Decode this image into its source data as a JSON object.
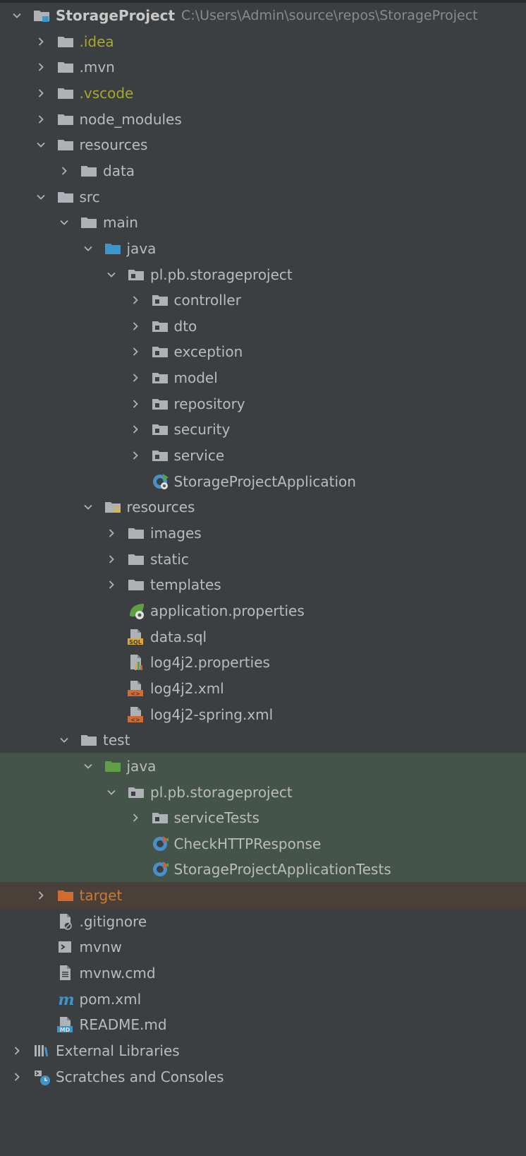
{
  "project": {
    "name": "StorageProject",
    "path": "C:\\Users\\Admin\\source\\repos\\StorageProject"
  },
  "colors": {
    "text": "#bbbbbb",
    "excluded": "#a8a82c",
    "target": "#c87a38",
    "test_highlight": "#45544a",
    "target_highlight": "#4a4039",
    "folder": "#aeb1b5",
    "java_source": "#3e95c9",
    "java_test": "#5fa046",
    "target_folder": "#d36b2f"
  },
  "tree": [
    {
      "label": "StorageProject",
      "depth": 0,
      "expanded": true,
      "icon": "project-folder-icon",
      "bold": true
    },
    {
      "label": ".idea",
      "depth": 1,
      "expanded": false,
      "icon": "folder-icon",
      "style": "olive"
    },
    {
      "label": ".mvn",
      "depth": 1,
      "expanded": false,
      "icon": "folder-icon"
    },
    {
      "label": ".vscode",
      "depth": 1,
      "expanded": false,
      "icon": "folder-icon",
      "style": "olive"
    },
    {
      "label": "node_modules",
      "depth": 1,
      "expanded": false,
      "icon": "folder-icon"
    },
    {
      "label": "resources",
      "depth": 1,
      "expanded": true,
      "icon": "folder-icon"
    },
    {
      "label": "data",
      "depth": 2,
      "expanded": false,
      "icon": "folder-icon"
    },
    {
      "label": "src",
      "depth": 1,
      "expanded": true,
      "icon": "folder-icon"
    },
    {
      "label": "main",
      "depth": 2,
      "expanded": true,
      "icon": "folder-icon"
    },
    {
      "label": "java",
      "depth": 3,
      "expanded": true,
      "icon": "source-folder-icon"
    },
    {
      "label": "pl.pb.storageproject",
      "depth": 4,
      "expanded": true,
      "icon": "package-icon"
    },
    {
      "label": "controller",
      "depth": 5,
      "expanded": false,
      "icon": "package-icon"
    },
    {
      "label": "dto",
      "depth": 5,
      "expanded": false,
      "icon": "package-icon"
    },
    {
      "label": "exception",
      "depth": 5,
      "expanded": false,
      "icon": "package-icon"
    },
    {
      "label": "model",
      "depth": 5,
      "expanded": false,
      "icon": "package-icon"
    },
    {
      "label": "repository",
      "depth": 5,
      "expanded": false,
      "icon": "package-icon"
    },
    {
      "label": "security",
      "depth": 5,
      "expanded": false,
      "icon": "package-icon"
    },
    {
      "label": "service",
      "depth": 5,
      "expanded": false,
      "icon": "package-icon"
    },
    {
      "label": "StorageProjectApplication",
      "depth": 5,
      "icon": "spring-boot-class-icon"
    },
    {
      "label": "resources",
      "depth": 3,
      "expanded": true,
      "icon": "resources-folder-icon"
    },
    {
      "label": "images",
      "depth": 4,
      "expanded": false,
      "icon": "folder-icon"
    },
    {
      "label": "static",
      "depth": 4,
      "expanded": false,
      "icon": "folder-icon"
    },
    {
      "label": "templates",
      "depth": 4,
      "expanded": false,
      "icon": "folder-icon"
    },
    {
      "label": "application.properties",
      "depth": 4,
      "icon": "spring-properties-icon"
    },
    {
      "label": "data.sql",
      "depth": 4,
      "icon": "sql-file-icon"
    },
    {
      "label": "log4j2.properties",
      "depth": 4,
      "icon": "properties-file-icon"
    },
    {
      "label": "log4j2.xml",
      "depth": 4,
      "icon": "xml-file-icon"
    },
    {
      "label": "log4j2-spring.xml",
      "depth": 4,
      "icon": "xml-file-icon"
    },
    {
      "label": "test",
      "depth": 2,
      "expanded": true,
      "icon": "folder-icon"
    },
    {
      "label": "java",
      "depth": 3,
      "expanded": true,
      "icon": "test-source-folder-icon",
      "highlight": "green"
    },
    {
      "label": "pl.pb.storageproject",
      "depth": 4,
      "expanded": true,
      "icon": "package-icon",
      "highlight": "green"
    },
    {
      "label": "serviceTests",
      "depth": 5,
      "expanded": false,
      "icon": "package-icon",
      "highlight": "green"
    },
    {
      "label": "CheckHTTPResponse",
      "depth": 5,
      "icon": "test-class-icon",
      "highlight": "green"
    },
    {
      "label": "StorageProjectApplicationTests",
      "depth": 5,
      "icon": "test-class-icon",
      "highlight": "green"
    },
    {
      "label": "target",
      "depth": 1,
      "expanded": false,
      "icon": "target-folder-icon",
      "style": "orange",
      "highlight": "brown"
    },
    {
      "label": ".gitignore",
      "depth": 1,
      "icon": "gitignore-file-icon"
    },
    {
      "label": "mvnw",
      "depth": 1,
      "icon": "shell-script-icon"
    },
    {
      "label": "mvnw.cmd",
      "depth": 1,
      "icon": "text-file-icon"
    },
    {
      "label": "pom.xml",
      "depth": 1,
      "icon": "maven-pom-icon"
    },
    {
      "label": "README.md",
      "depth": 1,
      "icon": "markdown-file-icon"
    },
    {
      "label": "External Libraries",
      "depth": 0,
      "expanded": false,
      "icon": "external-libraries-icon"
    },
    {
      "label": "Scratches and Consoles",
      "depth": 0,
      "expanded": false,
      "icon": "scratches-icon"
    }
  ]
}
